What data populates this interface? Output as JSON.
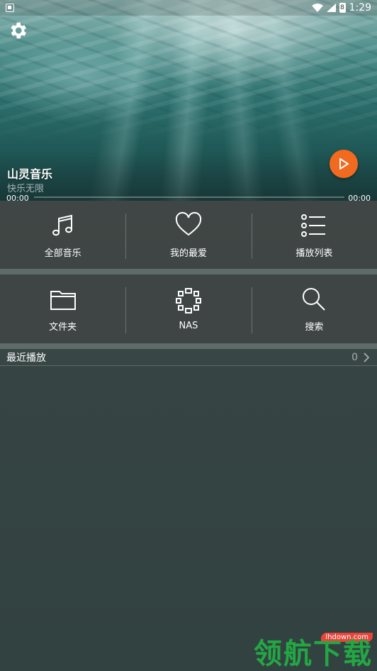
{
  "status_bar": {
    "time": "1:29",
    "battery_label": "8"
  },
  "player": {
    "title": "山灵音乐",
    "subtitle": "快乐无限",
    "time_current": "00:00",
    "time_total": "00:00",
    "progress": 0,
    "accent_color": "#f26a1f"
  },
  "grid_row1": [
    {
      "label": "全部音乐",
      "icon": "music-note-icon"
    },
    {
      "label": "我的最爱",
      "icon": "heart-icon"
    },
    {
      "label": "播放列表",
      "icon": "playlist-icon"
    }
  ],
  "grid_row2": [
    {
      "label": "文件夹",
      "icon": "folder-icon"
    },
    {
      "label": "NAS",
      "icon": "nas-icon"
    },
    {
      "label": "搜索",
      "icon": "search-icon"
    }
  ],
  "recent": {
    "label": "最近播放",
    "count": "0"
  },
  "watermark": {
    "domain": "lhdown.com",
    "text": "领航下载"
  }
}
